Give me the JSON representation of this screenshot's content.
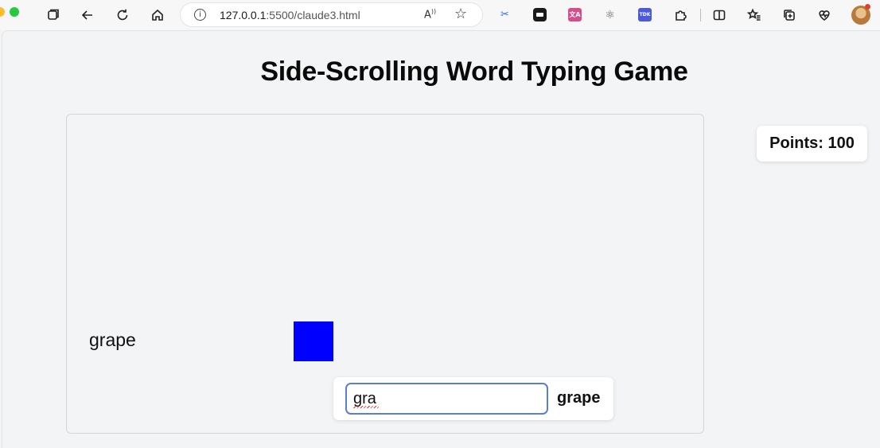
{
  "browser": {
    "url_host": "127.0.0.1",
    "url_rest": ":5500/claude3.html",
    "read_aloud_glyph": "A",
    "icons": {
      "tabs": "tabs-icon",
      "back": "back-arrow-icon",
      "reload": "reload-icon",
      "home": "home-icon",
      "info": "info-icon",
      "read_aloud": "read-aloud-icon",
      "favorite": "star-icon",
      "extensions": "puzzle-icon",
      "split_screen": "split-screen-icon",
      "favorites_list": "favorites-icon",
      "collections": "collections-icon",
      "performance": "heart-pulse-icon",
      "profile": "avatar"
    },
    "extension_labels": {
      "ext_tdk": "TDK",
      "ext_translate": "文A"
    },
    "colors": {
      "ext_scissors": "#2b6cd8",
      "ext_translate": "#d64d8b",
      "ext_tdk": "#4a5ad8"
    }
  },
  "page": {
    "title": "Side-Scrolling Word Typing Game"
  },
  "game": {
    "scrolling_word": "grape",
    "player_color": "#0000ff",
    "input_value": "gra",
    "target_word": "grape",
    "points_text": "Points: 100"
  }
}
